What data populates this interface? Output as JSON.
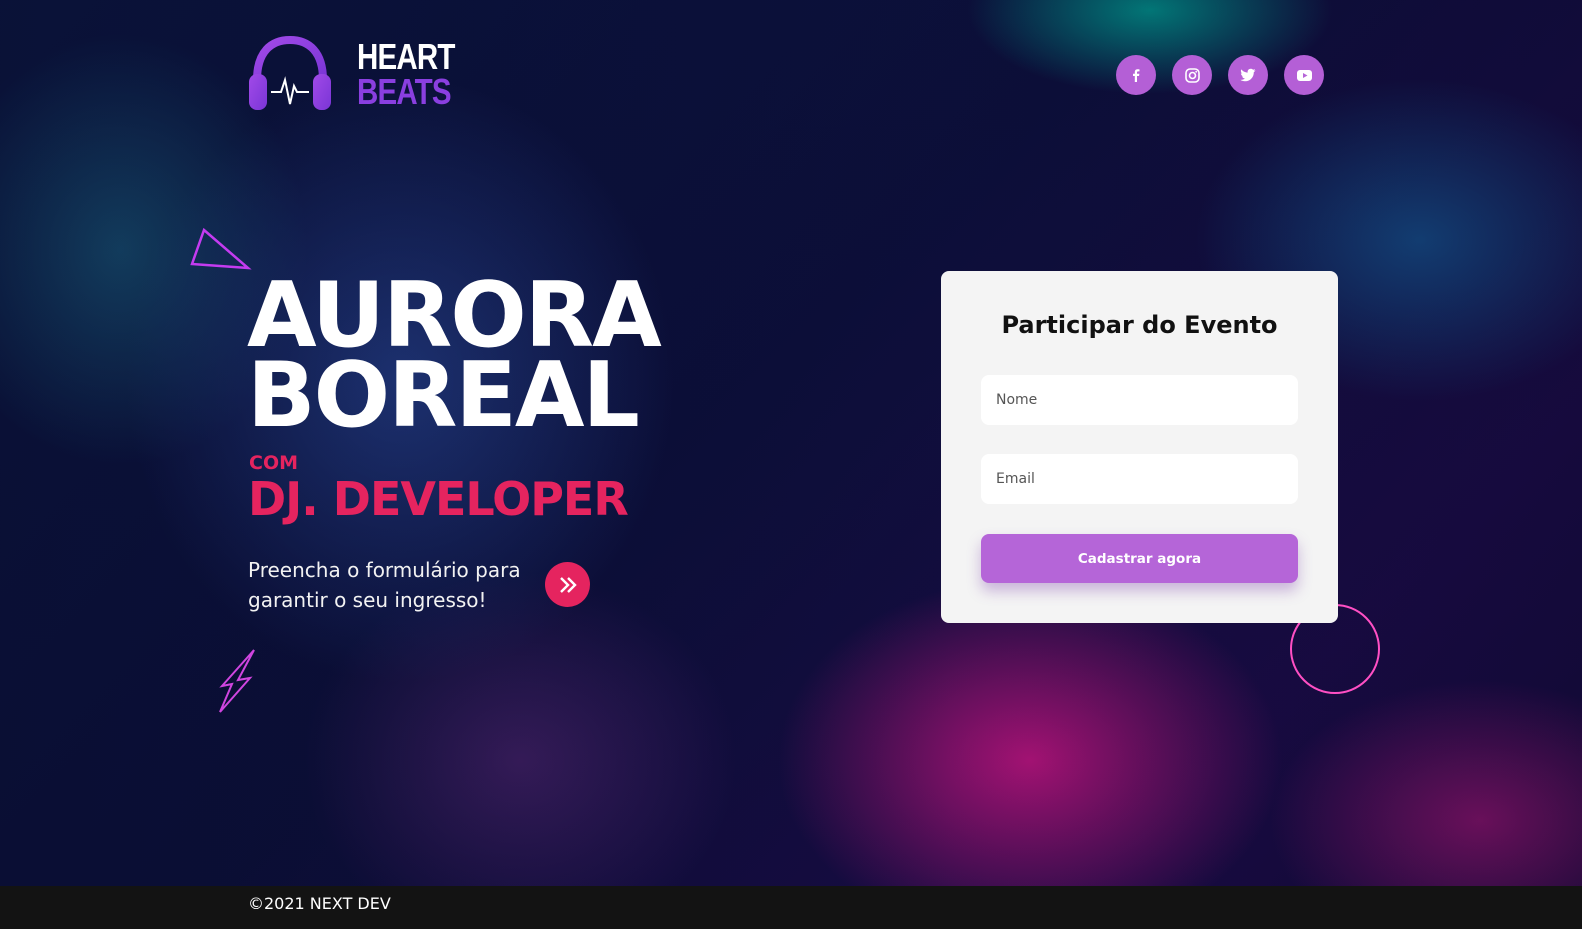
{
  "header": {
    "logo_line1": "HEART",
    "logo_line2": "BEATS",
    "social": [
      {
        "icon": "facebook-icon",
        "label": "f"
      },
      {
        "icon": "instagram-icon",
        "label": ""
      },
      {
        "icon": "twitter-icon",
        "label": ""
      },
      {
        "icon": "youtube-icon",
        "label": ""
      }
    ]
  },
  "hero": {
    "title_line1": "AURORA",
    "title_line2": "BOREAL",
    "com": "COM",
    "dj": "DJ. DEVELOPER",
    "cta_text": "Preencha o formulário para garantir o seu ingresso!"
  },
  "form": {
    "title": "Participar do Evento",
    "name_placeholder": "Nome",
    "email_placeholder": "Email",
    "submit_label": "Cadastrar agora"
  },
  "footer": {
    "copyright": "©2021 NEXT DEV"
  },
  "colors": {
    "accent_purple": "#b565d8",
    "accent_pink": "#e5245f",
    "logo_purple": "#8a3fe0",
    "footer_bg": "#131313"
  }
}
